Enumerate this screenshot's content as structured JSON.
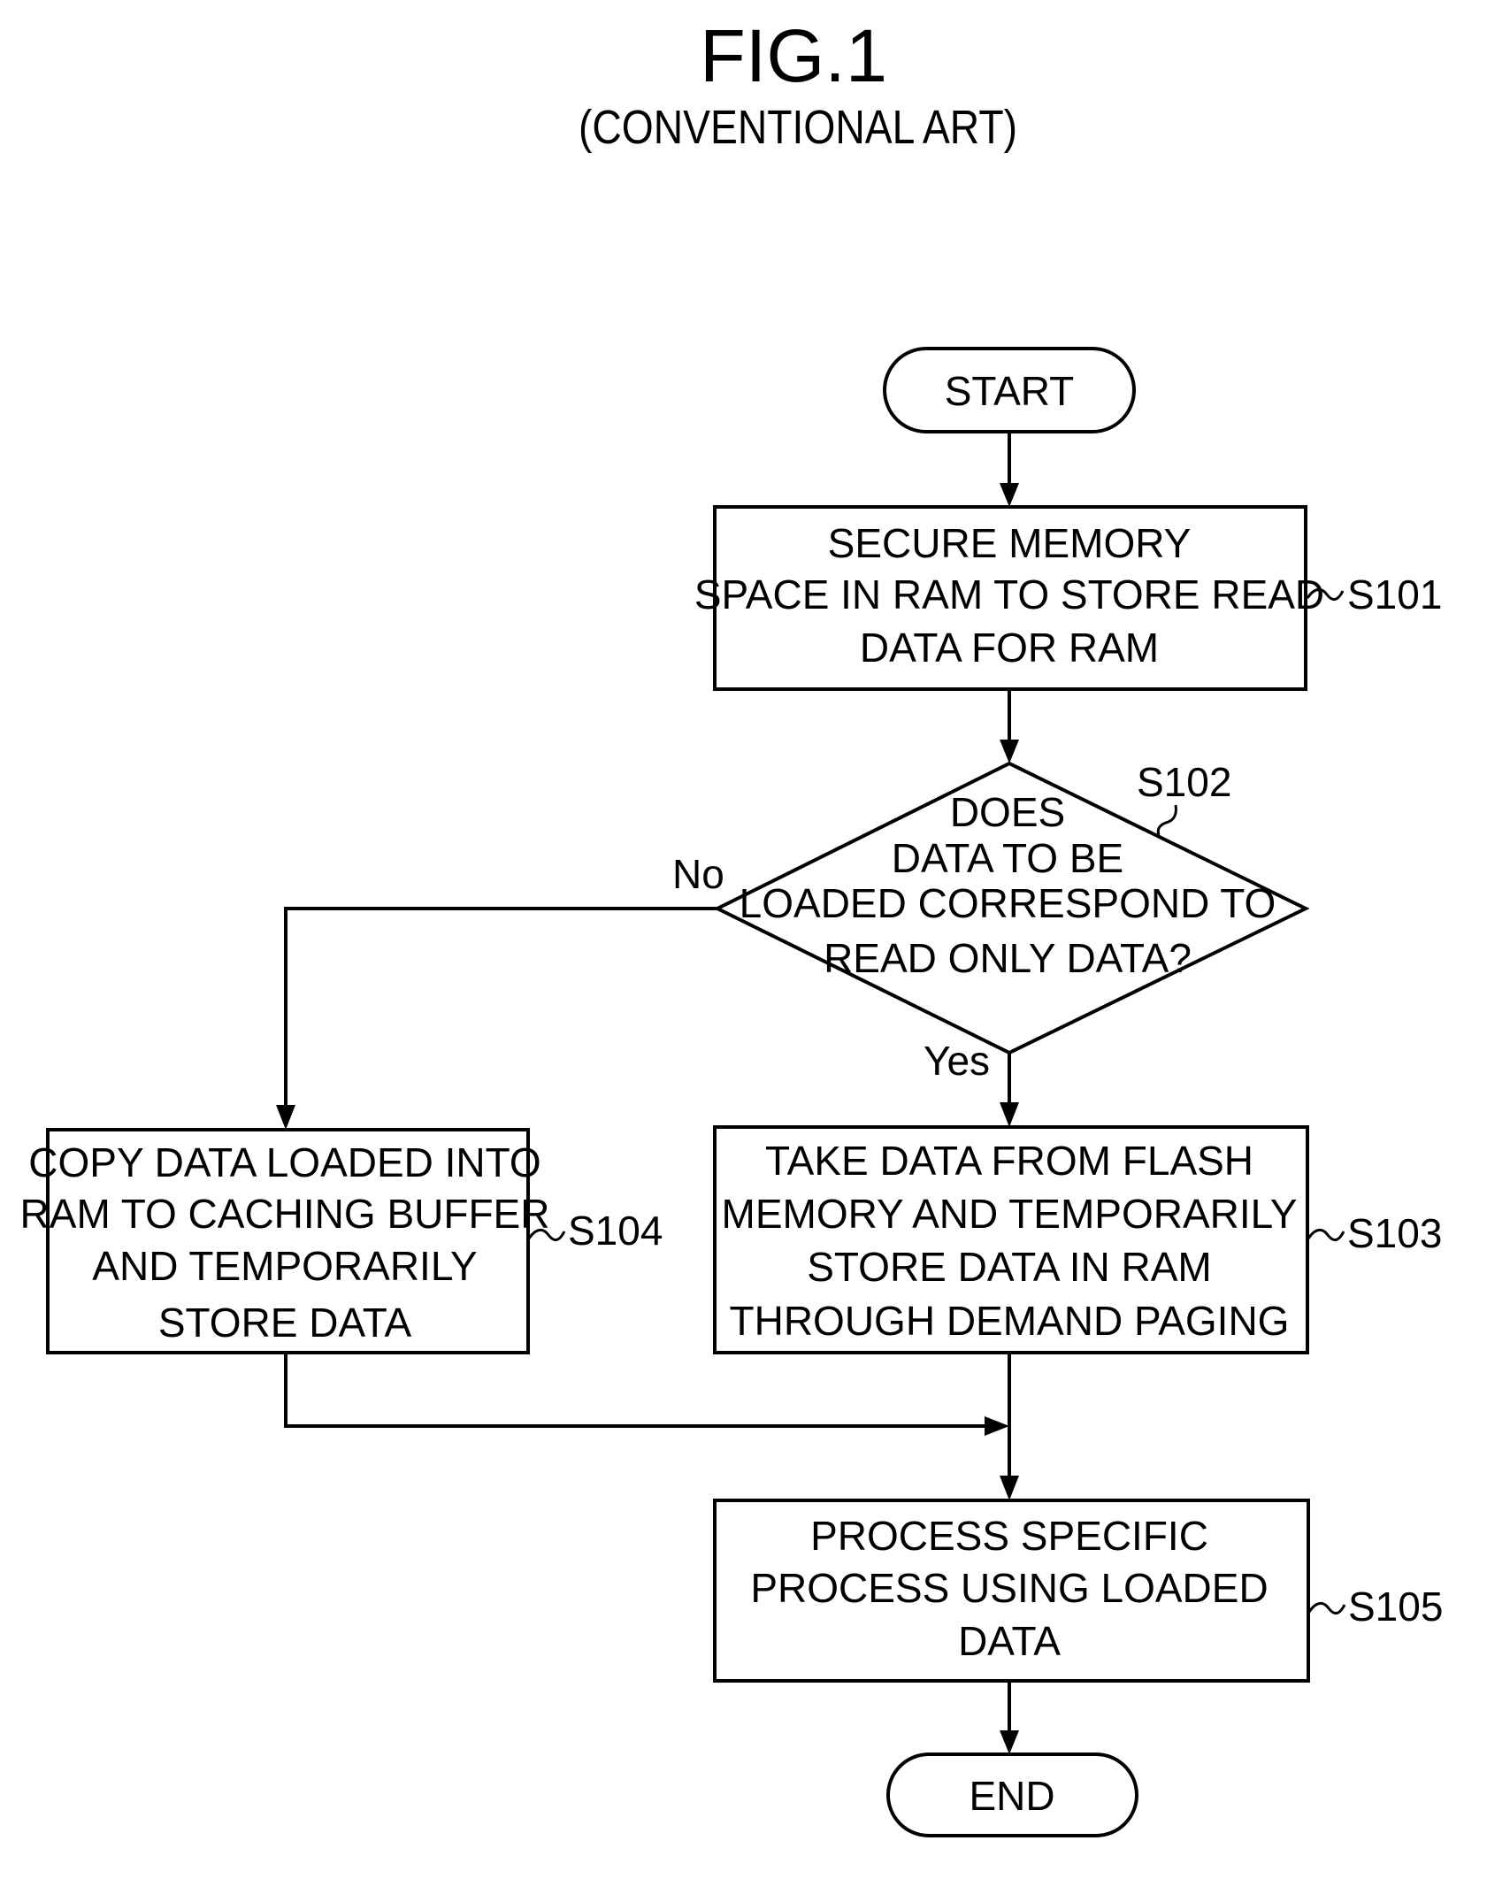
{
  "figure": {
    "title": "FIG.1",
    "subtitle": "(CONVENTIONAL ART)"
  },
  "nodes": {
    "start": {
      "type": "terminator",
      "lines": [
        "START"
      ]
    },
    "s101": {
      "type": "process",
      "step": "S101",
      "lines": [
        "SECURE MEMORY",
        "SPACE IN RAM TO STORE READ",
        "DATA FOR RAM"
      ]
    },
    "s102": {
      "type": "decision",
      "step": "S102",
      "lines": [
        "DOES",
        "DATA TO BE",
        "LOADED CORRESPOND TO",
        "READ ONLY DATA?"
      ]
    },
    "s103": {
      "type": "process",
      "step": "S103",
      "lines": [
        "TAKE DATA FROM FLASH",
        "MEMORY AND TEMPORARILY",
        "STORE DATA IN RAM",
        "THROUGH DEMAND PAGING"
      ]
    },
    "s104": {
      "type": "process",
      "step": "S104",
      "lines": [
        "COPY DATA LOADED INTO",
        "RAM TO CACHING BUFFER",
        "AND TEMPORARILY",
        "STORE DATA"
      ]
    },
    "s105": {
      "type": "process",
      "step": "S105",
      "lines": [
        "PROCESS SPECIFIC",
        "PROCESS USING LOADED",
        "DATA"
      ]
    },
    "end": {
      "type": "terminator",
      "lines": [
        "END"
      ]
    }
  },
  "edges": [
    {
      "from": "start",
      "to": "s101",
      "label": ""
    },
    {
      "from": "s101",
      "to": "s102",
      "label": ""
    },
    {
      "from": "s102",
      "to": "s104",
      "label": "No"
    },
    {
      "from": "s102",
      "to": "s103",
      "label": "Yes"
    },
    {
      "from": "s104",
      "to": "s105",
      "label": ""
    },
    {
      "from": "s103",
      "to": "s105",
      "label": ""
    },
    {
      "from": "s105",
      "to": "end",
      "label": ""
    }
  ],
  "branch_labels": {
    "no": "No",
    "yes": "Yes"
  }
}
